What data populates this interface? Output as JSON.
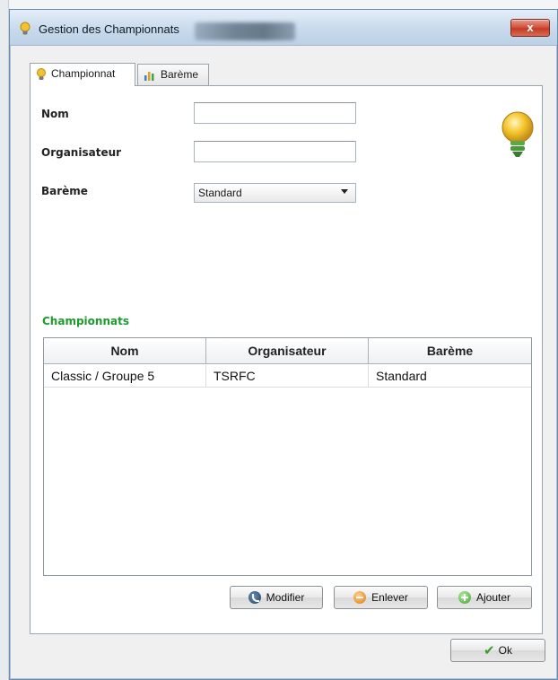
{
  "window": {
    "title": "Gestion des Championnats",
    "close_label": "x"
  },
  "tabs": [
    {
      "label": "Championnat",
      "icon": "bulb-icon",
      "active": true
    },
    {
      "label": "Barème",
      "icon": "bar-chart-icon",
      "active": false
    }
  ],
  "form": {
    "nom_label": "Nom",
    "nom_value": "",
    "organisateur_label": "Organisateur",
    "organisateur_value": "",
    "bareme_label": "Barème",
    "bareme_value": "Standard"
  },
  "championnats": {
    "title": "Championnats",
    "title_color": "#1d9a2e",
    "columns": [
      "Nom",
      "Organisateur",
      "Barème"
    ],
    "rows": [
      [
        "Classic / Groupe 5",
        "TSRFC",
        "Standard"
      ]
    ]
  },
  "buttons": {
    "modifier": "Modifier",
    "enlever": "Enlever",
    "ajouter": "Ajouter",
    "ok": "Ok"
  }
}
